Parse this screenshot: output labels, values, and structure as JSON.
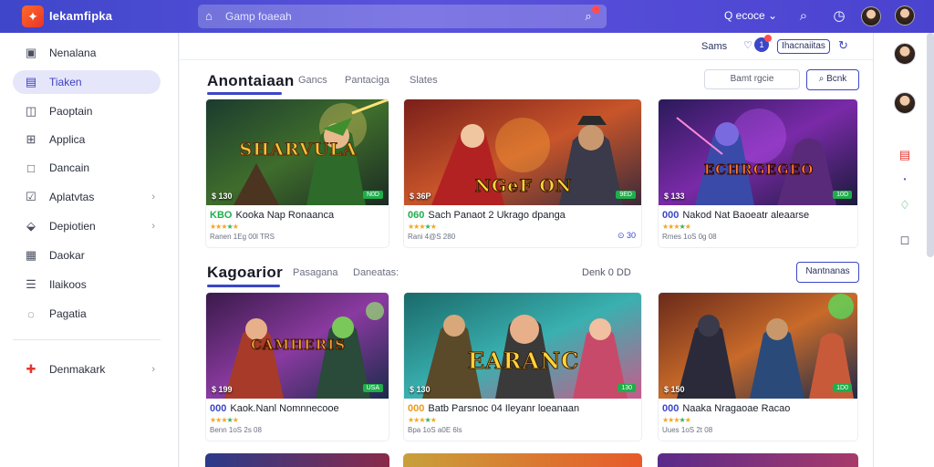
{
  "topbar": {
    "brand": "Iekamfipka",
    "search_placeholder": "Gamp foaeah",
    "account_label": "Q ecoce ⌄",
    "icons": [
      "logo-icon",
      "search-icon",
      "camera-search-icon",
      "search-icon",
      "clock-icon",
      "avatar",
      "avatar"
    ]
  },
  "sidebar": {
    "items": [
      {
        "label": "Nenalana",
        "icon": "store-icon",
        "active": false,
        "chevron": false
      },
      {
        "label": "Tiaken",
        "icon": "library-icon",
        "active": true,
        "chevron": false
      },
      {
        "label": "Paoptain",
        "icon": "bag-icon",
        "active": false,
        "chevron": false
      },
      {
        "label": "Applica",
        "icon": "grid-icon",
        "active": false,
        "chevron": false
      },
      {
        "label": "Dancain",
        "icon": "square-icon",
        "active": false,
        "chevron": false
      },
      {
        "label": "Aplatvtas",
        "icon": "check-box-icon",
        "active": false,
        "chevron": true
      },
      {
        "label": "Depiotien",
        "icon": "tag-icon",
        "active": false,
        "chevron": true
      },
      {
        "label": "Daokar",
        "icon": "calendar-icon",
        "active": false,
        "chevron": false
      },
      {
        "label": "Ilaikoos",
        "icon": "list-icon",
        "active": false,
        "chevron": false
      },
      {
        "label": "Pagatia",
        "icon": "location-icon",
        "active": false,
        "chevron": false
      }
    ],
    "special_item": {
      "label": "Denmakark",
      "icon": "puzzle-icon"
    }
  },
  "subbar": {
    "text": "Sams",
    "pill": "Ihacnaiitas",
    "notification_count": "1"
  },
  "section1": {
    "title": "Anontaiaan",
    "tabs": [
      "Gancs",
      "Pantaciga",
      "Slates"
    ],
    "filter": "Bamt rgcie",
    "button": "Bcnk"
  },
  "section2": {
    "title": "Kagoarior",
    "tabs": [
      "Pasagana",
      "Daneatas:"
    ],
    "right_text": "Denk  0 DD",
    "button": "Nantnanas"
  },
  "cards": [
    {
      "art_title": "SHARVULA",
      "price": "$ 130",
      "tag": "N0D",
      "code": "KBO",
      "title": "Kooka Nap Ronaanca",
      "meta": "Ranen 1Eg 00l TRS",
      "extra": ""
    },
    {
      "art_title": "NGeF ON",
      "price": "$ 36P",
      "tag": "9ED",
      "code": "060",
      "title": "Sach Panaot 2 Ukrago dpanga",
      "meta": "Rani 4@S 280",
      "extra": "⊙ 30"
    },
    {
      "art_title": "ECHRGEGEO",
      "price": "$ 133",
      "tag": "10D",
      "code": "000",
      "title": "Nakod Nat Baoeatr aleaarse",
      "meta": "Rmes 1oS 0g 08",
      "extra": ""
    },
    {
      "art_title": "CAMHERIS",
      "price": "$ 199",
      "tag": "USA",
      "code": "000",
      "title": "Kaok.Nanl Nomnnecooe",
      "meta": "Benn 1oS 2s 08",
      "extra": ""
    },
    {
      "art_title": "EARANC",
      "price": "$ 130",
      "tag": "130",
      "code": "000",
      "title": "Batb Parsnoc 04 Ileyanr loeanaan",
      "meta": "Bpa 1oS a0E 6ls",
      "extra": ""
    },
    {
      "art_title": "",
      "price": "$ 150",
      "tag": "1D0",
      "code": "000",
      "title": "Naaka Nragaoae Racao",
      "meta": "Uues 1oS 2t 08",
      "extra": ""
    }
  ],
  "rail": {
    "icons": [
      "avatar",
      "avatar",
      "gift-icon",
      "dot-icon",
      "bell-icon",
      "message-icon"
    ]
  },
  "colors": {
    "accent": "#3b46c8",
    "topbar": "#4f4bd6",
    "active_nav": "#e6e6fb",
    "badge_green": "#1fae4b",
    "alert_red": "#ff4d4f"
  }
}
